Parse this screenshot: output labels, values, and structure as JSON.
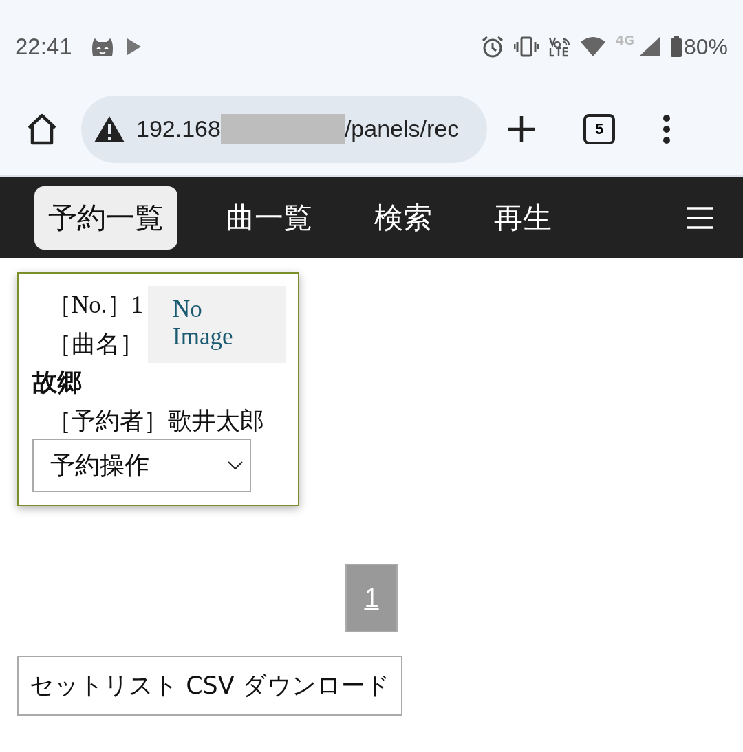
{
  "status_bar": {
    "time": "22:41",
    "network": "4G",
    "battery": "80%"
  },
  "browser": {
    "url_start": "192.168",
    "url_end": "/panels/rec",
    "tab_count": "5"
  },
  "nav": {
    "tabs": [
      {
        "label": "予約一覧",
        "selected": true
      },
      {
        "label": "曲一覧",
        "selected": false
      },
      {
        "label": "検索",
        "selected": false
      },
      {
        "label": "再生",
        "selected": false
      }
    ]
  },
  "reservations": [
    {
      "no_label": "［No.］",
      "no": "1",
      "title_label": "［曲名］",
      "title": "故郷",
      "singer_label": "［予約者］",
      "singer": "歌井太郎",
      "image_text": "No Image",
      "action": "予約操作"
    }
  ],
  "pagination": [
    {
      "label": "1",
      "selected": true
    }
  ],
  "csv_button": "セットリスト CSV ダウンロード"
}
